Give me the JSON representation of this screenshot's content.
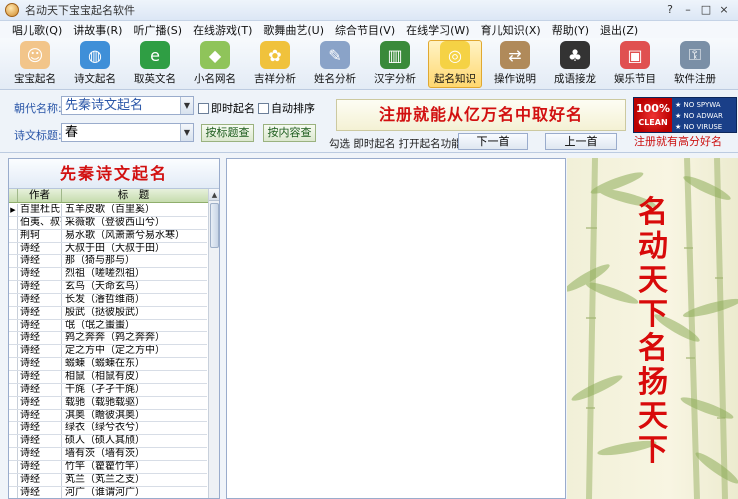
{
  "window": {
    "title": "名动天下宝宝起名软件",
    "buttons": [
      "?",
      "–",
      "□",
      "×"
    ]
  },
  "menu": [
    "唱儿歌(Q)",
    "讲故事(R)",
    "听广播(S)",
    "在线游戏(T)",
    "歌舞曲艺(U)",
    "综合节目(V)",
    "在线学习(W)",
    "育儿知识(X)",
    "帮助(Y)",
    "退出(Z)"
  ],
  "toolbar": [
    {
      "label": "宝宝起名",
      "icon": "baby-face-icon",
      "color": "#f2c58a",
      "glyph": "☺"
    },
    {
      "label": "诗文起名",
      "icon": "globe-icon",
      "color": "#3f8fd8",
      "glyph": "◍"
    },
    {
      "label": "取英文名",
      "icon": "english-leaf-icon",
      "color": "#2f9e44",
      "glyph": "e"
    },
    {
      "label": "小名网名",
      "icon": "tag-icon",
      "color": "#8fc45a",
      "glyph": "◆"
    },
    {
      "label": "吉祥分析",
      "icon": "lucky-bag-icon",
      "color": "#f0c23c",
      "glyph": "✿"
    },
    {
      "label": "姓名分析",
      "icon": "notebook-icon",
      "color": "#8aa3c8",
      "glyph": "✎"
    },
    {
      "label": "汉字分析",
      "icon": "books-icon",
      "color": "#3a8a3a",
      "glyph": "▥"
    },
    {
      "label": "起名知识",
      "icon": "cd-disc-icon",
      "color": "#f5d245",
      "glyph": "◎"
    },
    {
      "label": "操作说明",
      "icon": "signpost-icon",
      "color": "#b08a5a",
      "glyph": "⇄"
    },
    {
      "label": "成语接龙",
      "icon": "penguin-icon",
      "color": "#333333",
      "glyph": "♣"
    },
    {
      "label": "娱乐节目",
      "icon": "window-gift-icon",
      "color": "#e05050",
      "glyph": "▣"
    },
    {
      "label": "软件注册",
      "icon": "keys-icon",
      "color": "#7a8fa6",
      "glyph": "⚿"
    }
  ],
  "active_tool_index": 7,
  "form": {
    "dynasty_label": "朝代名称:",
    "dynasty_value": "先秦诗文起名",
    "title_label": "诗文标题:",
    "title_value": "春",
    "instant_naming": "即时起名",
    "auto_sort": "自动排序",
    "search_title_button": "按标题查",
    "search_content_button": "按内容查",
    "banner": "注册就能从亿万名中取好名",
    "hint_text": "勾选  即时起名  打开起名功能",
    "next_button": "下一首",
    "prev_button": "上一首",
    "slogan": "注册就有高分好名",
    "clean_badge": {
      "big": "100%",
      "small": "CLEAN",
      "items": [
        "NO SPYWA",
        "NO ADWAR",
        "NO VIRUSE"
      ]
    }
  },
  "left_panel": {
    "header": "先秦诗文起名",
    "columns": [
      "作者",
      "标　题"
    ],
    "rows": [
      [
        "百里杜氏",
        "五羊皮歌（百里奚）"
      ],
      [
        "伯夷、叔齐",
        "采薇歌（登彼西山兮）"
      ],
      [
        "荆轲",
        "易水歌（风萧萧兮易水寒）"
      ],
      [
        "诗经",
        "大叔于田（大叔于田）"
      ],
      [
        "诗经",
        "那（猗与那与）"
      ],
      [
        "诗经",
        "烈祖（嗟嗟烈祖）"
      ],
      [
        "诗经",
        "玄鸟（天命玄鸟）"
      ],
      [
        "诗经",
        "长发（濬哲维商）"
      ],
      [
        "诗经",
        "殷武（挞彼殷武）"
      ],
      [
        "诗经",
        "氓（氓之蚩蚩）"
      ],
      [
        "诗经",
        "鹑之奔奔（鹑之奔奔）"
      ],
      [
        "诗经",
        "定之方中（定之方中）"
      ],
      [
        "诗经",
        "蝃蝀（蝃蝀在东）"
      ],
      [
        "诗经",
        "相鼠（相鼠有皮）"
      ],
      [
        "诗经",
        "干旄（孑孑干旄）"
      ],
      [
        "诗经",
        "载驰（载驰载驱）"
      ],
      [
        "诗经",
        "淇奥（瞻彼淇奥）"
      ],
      [
        "诗经",
        "绿衣（绿兮衣兮）"
      ],
      [
        "诗经",
        "硕人（硕人其颀）"
      ],
      [
        "诗经",
        "墙有茨（墙有茨）"
      ],
      [
        "诗经",
        "竹竿（籊籊竹竿）"
      ],
      [
        "诗经",
        "芄兰（芄兰之支）"
      ],
      [
        "诗经",
        "河广（谁谓河广）"
      ]
    ]
  },
  "right_panel": {
    "vertical_text": "名动天下名扬天下"
  }
}
